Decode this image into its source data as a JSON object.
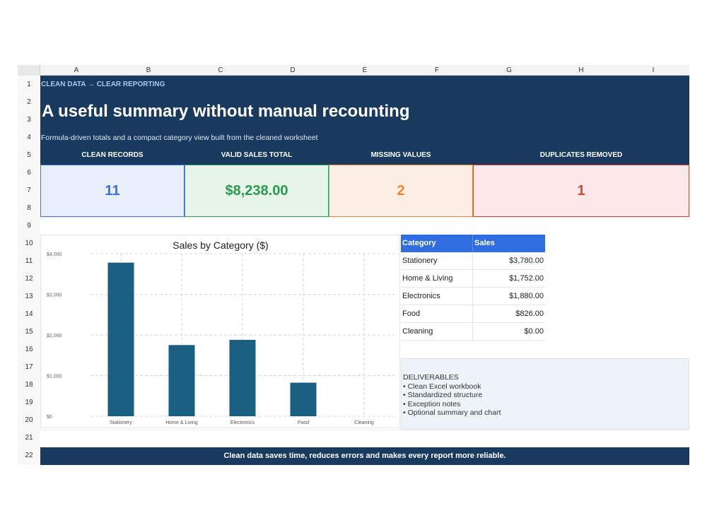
{
  "columns": [
    "A",
    "B",
    "C",
    "D",
    "E",
    "F",
    "G",
    "H",
    "I"
  ],
  "rows": [
    "1",
    "2",
    "3",
    "4",
    "5",
    "6",
    "7",
    "8",
    "9",
    "10",
    "11",
    "12",
    "13",
    "14",
    "15",
    "16",
    "17",
    "18",
    "19",
    "20",
    "21",
    "22"
  ],
  "banner": {
    "kicker": "CLEAN DATA → CLEAR REPORTING",
    "title": "A useful summary without manual recounting",
    "subtitle": "Formula-driven totals and a compact category view built from the cleaned worksheet"
  },
  "kpis": [
    {
      "label": "CLEAN RECORDS",
      "value": "11",
      "color": "#3a73d6"
    },
    {
      "label": "VALID SALES TOTAL",
      "value": "$8,238.00",
      "color": "#2c9a4d"
    },
    {
      "label": "MISSING VALUES",
      "value": "2",
      "color": "#ef8733"
    },
    {
      "label": "DUPLICATES REMOVED",
      "value": "1",
      "color": "#d54237"
    }
  ],
  "chart_data": {
    "type": "bar",
    "title": "Sales by Category ($)",
    "categories": [
      "Stationery",
      "Home & Living",
      "Electronics",
      "Food",
      "Cleaning"
    ],
    "values": [
      3780,
      1752,
      1880,
      826,
      0
    ],
    "ylim": [
      0,
      4000
    ],
    "yticks": [
      0,
      1000,
      2000,
      3000,
      4000
    ],
    "ytick_labels": [
      "$0",
      "$1,000",
      "$2,000",
      "$3,000",
      "$4,000"
    ],
    "bar_color": "#185f82",
    "grid": true
  },
  "table": {
    "headers": [
      "Category",
      "Sales"
    ],
    "rows": [
      [
        "Stationery",
        "$3,780.00"
      ],
      [
        "Home & Living",
        "$1,752.00"
      ],
      [
        "Electronics",
        "$1,880.00"
      ],
      [
        "Food",
        "$826.00"
      ],
      [
        "Cleaning",
        "$0.00"
      ]
    ]
  },
  "deliverables": {
    "title": "DELIVERABLES",
    "items": [
      "• Clean Excel workbook",
      "• Standardized structure",
      "• Exception notes",
      "• Optional summary and chart"
    ]
  },
  "footer": "Clean data saves time, reduces errors and makes every report more reliable.",
  "colors": {
    "navy": "#183a5e",
    "table_header": "#2f6de0"
  }
}
